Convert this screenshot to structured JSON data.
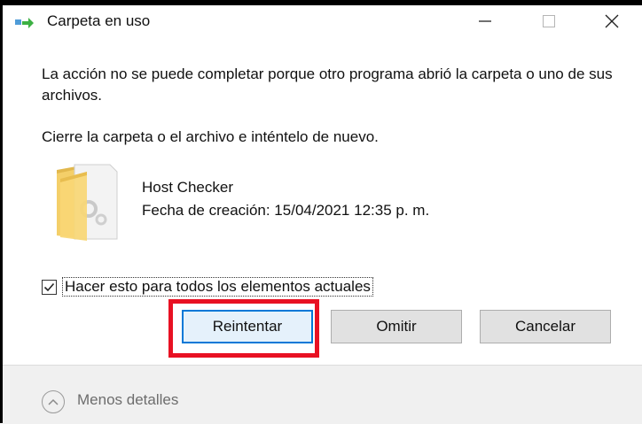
{
  "window": {
    "title": "Carpeta en uso",
    "controls": [
      "minimize-icon",
      "maximize-icon",
      "close-icon"
    ]
  },
  "message": {
    "line1": "La acción no se puede completar porque otro programa abrió la carpeta o uno de sus archivos.",
    "line2": "Cierre la carpeta o el archivo e inténtelo de nuevo."
  },
  "item": {
    "icon": "folder-icon",
    "name": "Host Checker",
    "created": "Fecha de creación: 15/04/2021 12:35 p. m."
  },
  "checkbox": {
    "label": "Hacer esto para todos los elementos actuales",
    "checked": true
  },
  "buttons": {
    "retry": "Reintentar",
    "skip": "Omitir",
    "cancel": "Cancelar"
  },
  "footer": {
    "toggle_label": "Menos detalles"
  },
  "colors": {
    "highlight": "#e81123",
    "focus_border": "#0078d7",
    "footer_bg": "#f0f0f0"
  }
}
